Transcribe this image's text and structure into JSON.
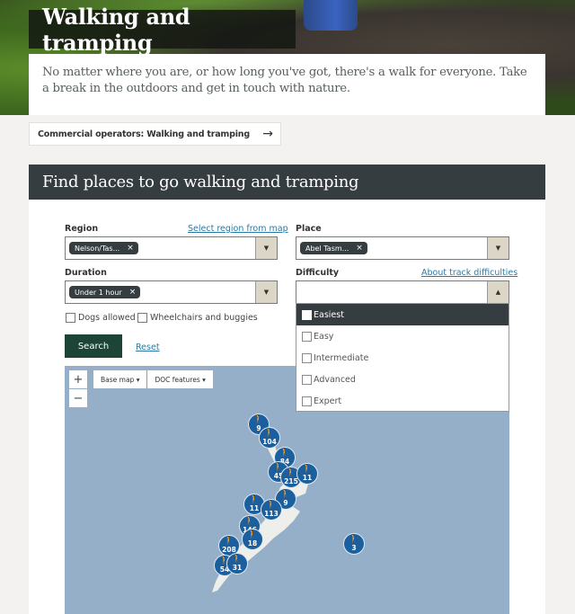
{
  "hero": {
    "title": "Walking and tramping",
    "intro": "No matter where you are, or how long you've got, there's a walk for everyone. Take a break in the outdoors and get in touch with nature."
  },
  "commercial_link": {
    "label": "Commercial operators: Walking and tramping",
    "icon": "arrow-right-icon",
    "arrow": "→"
  },
  "finder": {
    "title": "Find places to go walking and tramping",
    "region": {
      "label": "Region",
      "link": "Select region from map",
      "chip": "Nelson/Tas...",
      "chip_remove": "×"
    },
    "place": {
      "label": "Place",
      "chip": "Abel Tasm...",
      "chip_remove": "×"
    },
    "duration": {
      "label": "Duration",
      "chip": "Under 1 hour",
      "chip_remove": "×"
    },
    "difficulty": {
      "label": "Difficulty",
      "link": "About track difficulties",
      "value": "",
      "options": [
        {
          "label": "Easiest",
          "checked": false,
          "highlighted": true
        },
        {
          "label": "Easy",
          "checked": false
        },
        {
          "label": "Intermediate",
          "checked": false
        },
        {
          "label": "Advanced",
          "checked": false
        },
        {
          "label": "Expert",
          "checked": false
        }
      ]
    },
    "checkboxes": [
      {
        "label": "Dogs allowed",
        "checked": false
      },
      {
        "label": "Wheelchairs and buggies",
        "checked": false
      }
    ],
    "search_label": "Search",
    "reset_label": "Reset",
    "caret_down": "▼",
    "caret_up": "▲"
  },
  "map": {
    "zoom_in": "+",
    "zoom_out": "−",
    "base_map": "Base map ▾",
    "doc_features": "DOC features ▾",
    "cluster_icon": "hiker-icon",
    "clusters": [
      {
        "count": "9"
      },
      {
        "count": "104"
      },
      {
        "count": "84"
      },
      {
        "count": "45"
      },
      {
        "count": "215"
      },
      {
        "count": "11"
      },
      {
        "count": "9"
      },
      {
        "count": "11"
      },
      {
        "count": "113"
      },
      {
        "count": "146"
      },
      {
        "count": "18"
      },
      {
        "count": "208"
      },
      {
        "count": "54"
      },
      {
        "count": "31"
      },
      {
        "count": "3"
      }
    ]
  }
}
